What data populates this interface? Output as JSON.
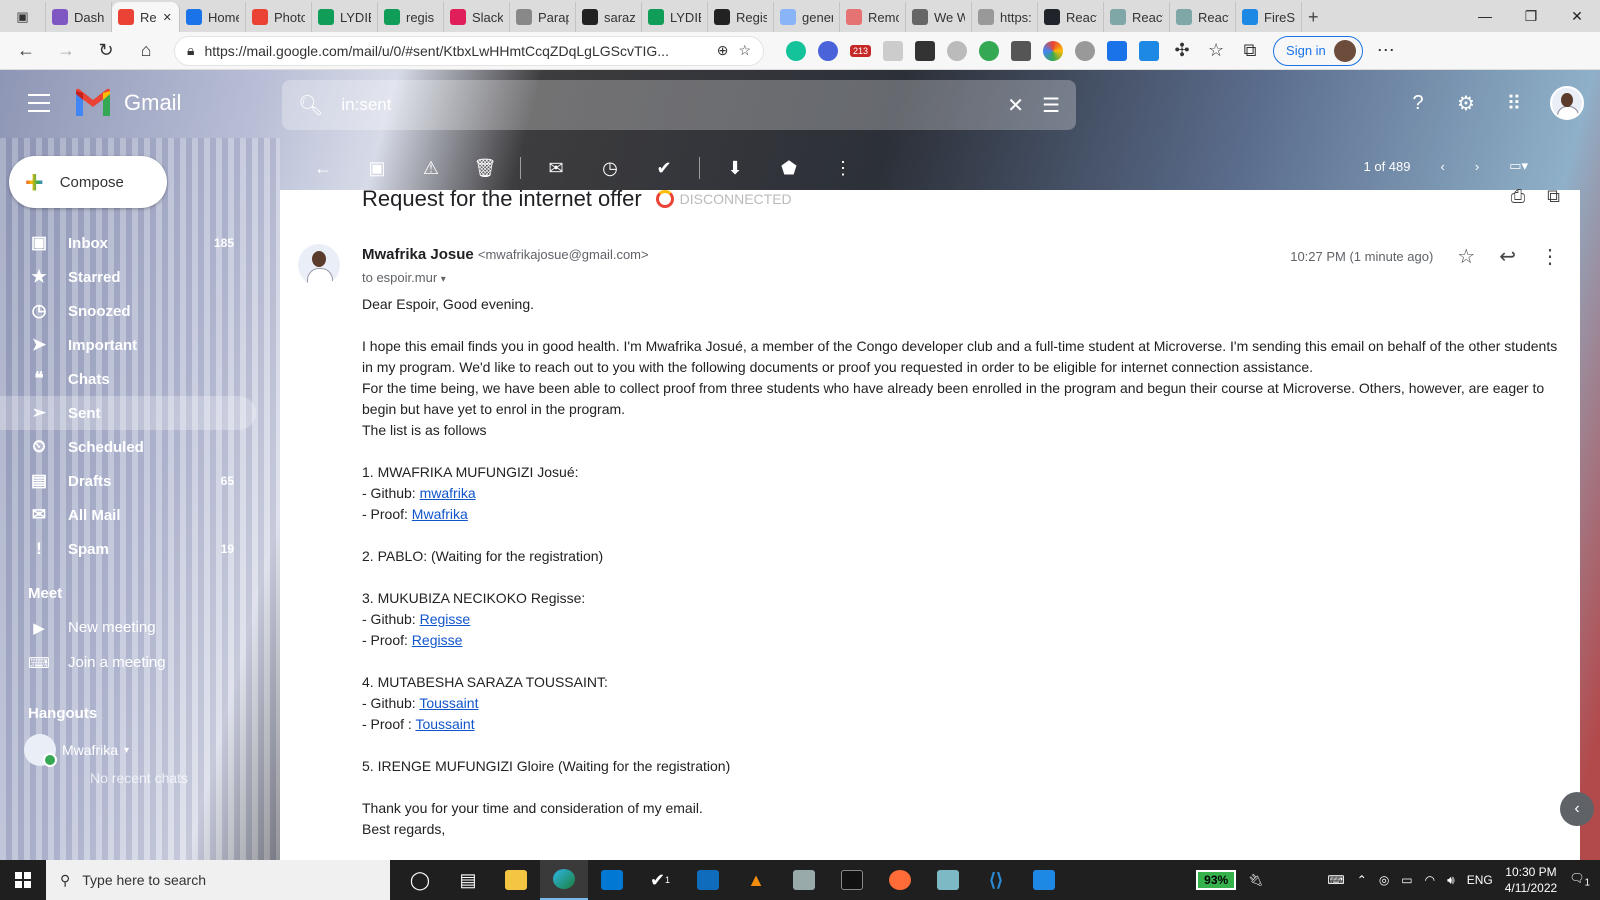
{
  "browser": {
    "tabs": [
      {
        "title": "Dashb",
        "color": "#7e57c2"
      },
      {
        "title": "Re",
        "color": "#ea4335",
        "active": true
      },
      {
        "title": "Home",
        "color": "#1a73e8"
      },
      {
        "title": "Photo",
        "color": "#ea4335"
      },
      {
        "title": "LYDIE",
        "color": "#0f9d58"
      },
      {
        "title": "regis",
        "color": "#0f9d58"
      },
      {
        "title": "Slack",
        "color": "#e01e5a"
      },
      {
        "title": "Parap",
        "color": "#888888"
      },
      {
        "title": "saraz",
        "color": "#222222"
      },
      {
        "title": "LYDIE",
        "color": "#0f9d58"
      },
      {
        "title": "Regis",
        "color": "#222222"
      },
      {
        "title": "gener",
        "color": "#8ab4f8"
      },
      {
        "title": "Remo",
        "color": "#e57373"
      },
      {
        "title": "We W",
        "color": "#666666"
      },
      {
        "title": "https:",
        "color": "#999999"
      },
      {
        "title": "React",
        "color": "#20232a"
      },
      {
        "title": "React",
        "color": "#7fa7a7"
      },
      {
        "title": "React",
        "color": "#7fa7a7"
      },
      {
        "title": "FireSh",
        "color": "#1e88e5"
      }
    ],
    "new_tab": "+",
    "url": "https://mail.google.com/mail/u/0/#sent/KtbxLwHHmtCcqZDqLgLGScvTIG...",
    "sign_in": "Sign in",
    "ext_badge": "213"
  },
  "gmail": {
    "logo_text": "Gmail",
    "search_query": "in:sent",
    "compose_label": "Compose",
    "nav": [
      {
        "label": "Inbox",
        "icon": "▣",
        "count": "185"
      },
      {
        "label": "Starred",
        "icon": "★",
        "count": ""
      },
      {
        "label": "Snoozed",
        "icon": "◷",
        "count": ""
      },
      {
        "label": "Important",
        "icon": "➤",
        "count": ""
      },
      {
        "label": "Chats",
        "icon": "❝",
        "count": ""
      },
      {
        "label": "Sent",
        "icon": "➢",
        "count": "",
        "active": true
      },
      {
        "label": "Scheduled",
        "icon": "⏲",
        "count": ""
      },
      {
        "label": "Drafts",
        "icon": "▤",
        "count": "65"
      },
      {
        "label": "All Mail",
        "icon": "✉",
        "count": ""
      },
      {
        "label": "Spam",
        "icon": "!",
        "count": "19"
      }
    ],
    "meet": {
      "heading": "Meet",
      "items": [
        {
          "label": "New meeting",
          "icon": "▶"
        },
        {
          "label": "Join a meeting",
          "icon": "⌨"
        }
      ]
    },
    "hangouts": {
      "heading": "Hangouts",
      "user": "Mwafrika",
      "no_recent": "No recent chats"
    },
    "pager": "1 of 489",
    "email": {
      "subject": "Request for the internet offer",
      "status": "DISCONNECTED",
      "sender_name": "Mwafrika Josue",
      "sender_email": "<mwafrikajosue@gmail.com>",
      "to": "to espoir.mur",
      "time": "10:27 PM (1 minute ago)",
      "greeting": "Dear Espoir, Good evening.",
      "para1": "I hope this email finds you in good health. I'm Mwafrika Josué, a member of the Congo developer club and a full-time student at Microverse. I'm sending this email on behalf of the other students in my program. We'd like to reach out to you with the following documents or proof you requested in order to be eligible for internet connection assistance.",
      "para2": "For the time being, we have been able to collect proof from three students who have already been enrolled in the program and begun their course at Microverse. Others, however, are eager to begin but have yet to enrol in the program.",
      "list_intro": "The list is as follows",
      "students": [
        {
          "name": "1. MWAFRIKA MUFUNGIZI Josué:",
          "github_label": "- Github: ",
          "github_link": "mwafrika",
          "proof_label": "- Proof: ",
          "proof_link": "Mwafrika"
        },
        {
          "name": "2. PABLO: (Waiting for the registration)"
        },
        {
          "name": "3. MUKUBIZA NECIKOKO Regisse:",
          "github_label": "- Github: ",
          "github_link": "Regisse",
          "proof_label": "- Proof: ",
          "proof_link": "Regisse"
        },
        {
          "name": "4. MUTABESHA SARAZA TOUSSAINT:",
          "github_label": "- Github: ",
          "github_link": "Toussaint",
          "proof_label": "- Proof : ",
          "proof_link": "Toussaint"
        },
        {
          "name": "5. IRENGE MUFUNGIZI Gloire (Waiting for the registration)"
        }
      ],
      "closing": "Thank you for your time and consideration of my email.",
      "signoff": "Best regards,"
    }
  },
  "taskbar": {
    "search_placeholder": "Type here to search",
    "battery": "93%",
    "lang": "ENG",
    "time": "10:30 PM",
    "date": "4/11/2022",
    "notif_count": "1",
    "mail_badge": "1"
  }
}
